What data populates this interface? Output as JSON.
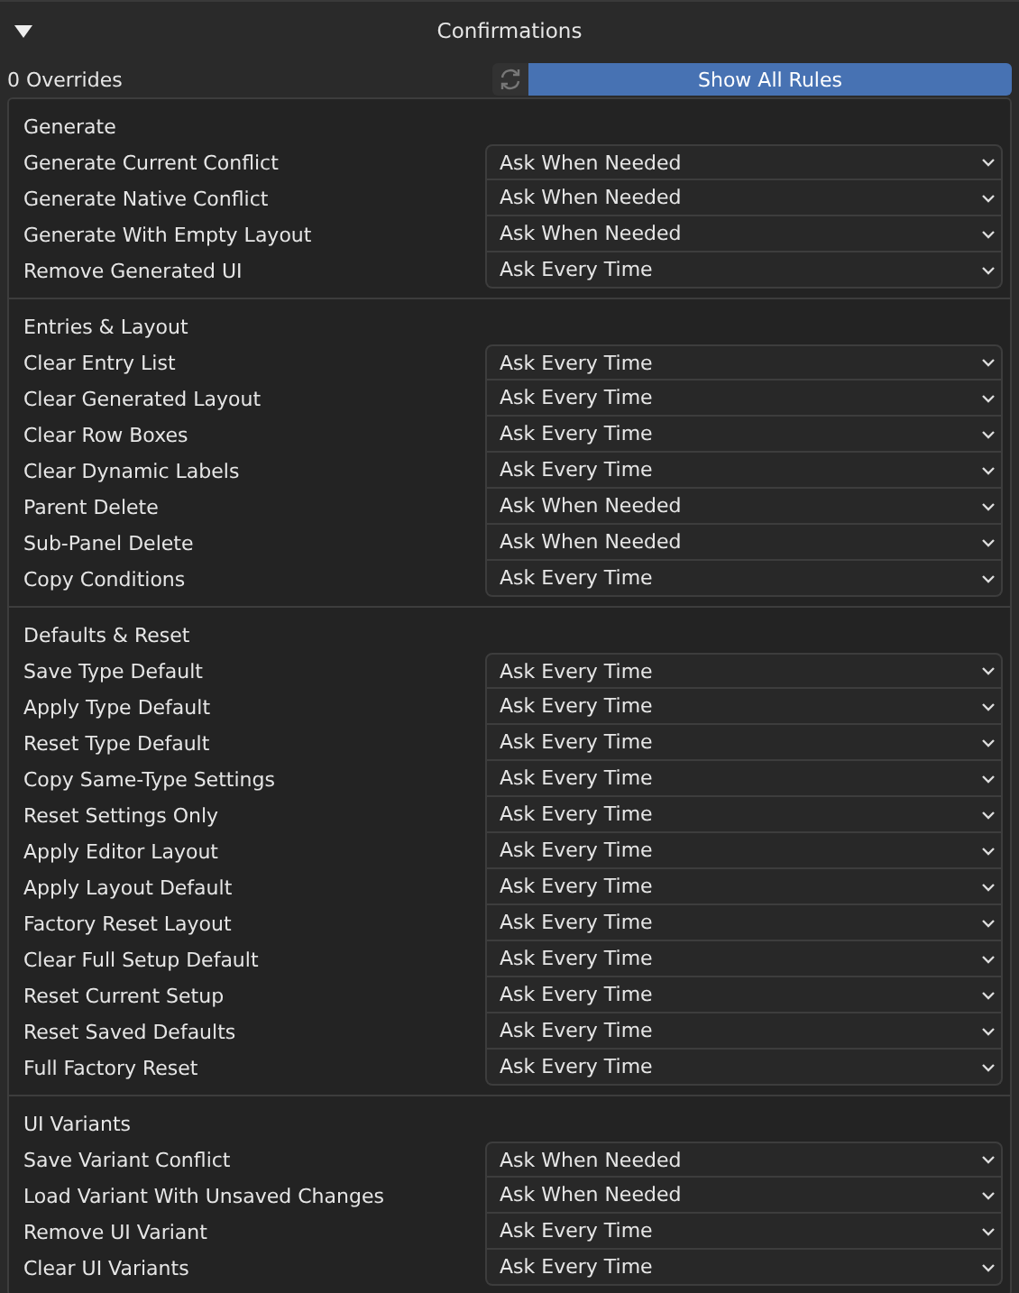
{
  "panel": {
    "title": "Confirmations",
    "expanded": true
  },
  "toolbar": {
    "overrides": "0 Overrides",
    "reset_disabled": true,
    "show_all": "Show All Rules",
    "show_all_selected": true
  },
  "sections": [
    {
      "title": "Generate",
      "rows": [
        {
          "label": "Generate Current Conflict",
          "value": "Ask When Needed"
        },
        {
          "label": "Generate Native Conflict",
          "value": "Ask When Needed"
        },
        {
          "label": "Generate With Empty Layout",
          "value": "Ask When Needed"
        },
        {
          "label": "Remove Generated UI",
          "value": "Ask Every Time"
        }
      ]
    },
    {
      "title": "Entries & Layout",
      "rows": [
        {
          "label": "Clear Entry List",
          "value": "Ask Every Time"
        },
        {
          "label": "Clear Generated Layout",
          "value": "Ask Every Time"
        },
        {
          "label": "Clear Row Boxes",
          "value": "Ask Every Time"
        },
        {
          "label": "Clear Dynamic Labels",
          "value": "Ask Every Time"
        },
        {
          "label": "Parent Delete",
          "value": "Ask When Needed"
        },
        {
          "label": "Sub-Panel Delete",
          "value": "Ask When Needed"
        },
        {
          "label": "Copy Conditions",
          "value": "Ask Every Time"
        }
      ]
    },
    {
      "title": "Defaults & Reset",
      "rows": [
        {
          "label": "Save Type Default",
          "value": "Ask Every Time"
        },
        {
          "label": "Apply Type Default",
          "value": "Ask Every Time"
        },
        {
          "label": "Reset Type Default",
          "value": "Ask Every Time"
        },
        {
          "label": "Copy Same-Type Settings",
          "value": "Ask Every Time"
        },
        {
          "label": "Reset Settings Only",
          "value": "Ask Every Time"
        },
        {
          "label": "Apply Editor Layout",
          "value": "Ask Every Time"
        },
        {
          "label": "Apply Layout Default",
          "value": "Ask Every Time"
        },
        {
          "label": "Factory Reset Layout",
          "value": "Ask Every Time"
        },
        {
          "label": "Clear Full Setup Default",
          "value": "Ask Every Time"
        },
        {
          "label": "Reset Current Setup",
          "value": "Ask Every Time"
        },
        {
          "label": "Reset Saved Defaults",
          "value": "Ask Every Time"
        },
        {
          "label": "Full Factory Reset",
          "value": "Ask Every Time"
        }
      ]
    },
    {
      "title": "UI Variants",
      "rows": [
        {
          "label": "Save Variant Conflict",
          "value": "Ask When Needed"
        },
        {
          "label": "Load Variant With Unsaved Changes",
          "value": "Ask When Needed"
        },
        {
          "label": "Remove UI Variant",
          "value": "Ask Every Time"
        },
        {
          "label": "Clear UI Variants",
          "value": "Ask Every Time"
        }
      ]
    }
  ]
}
